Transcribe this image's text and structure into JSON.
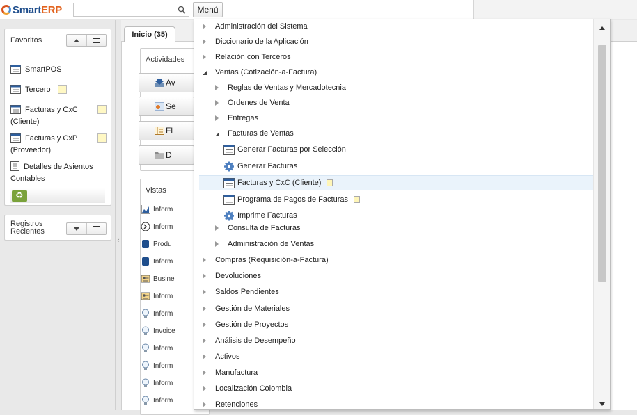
{
  "app": {
    "logo_part1": "Smart",
    "logo_part2": "ERP"
  },
  "search": {
    "placeholder": ""
  },
  "menu_button": "Menú",
  "favorites": {
    "title": "Favoritos",
    "items": [
      {
        "label": "SmartPOS",
        "icon": "window-icon"
      },
      {
        "label": "Tercero",
        "icon": "window-icon",
        "note": true
      },
      {
        "label": "Facturas y CxC (Cliente)",
        "icon": "window-icon",
        "note": true
      },
      {
        "label": "Facturas y CxP (Proveedor)",
        "icon": "window-icon",
        "note": true
      },
      {
        "label": "Detalles de Asientos Contables",
        "icon": "report-icon"
      }
    ]
  },
  "recent": {
    "title": "Registros Recientes"
  },
  "home_tab": "Inicio (35)",
  "activities": {
    "title": "Actividades",
    "buttons": [
      "Av",
      "Se",
      "Fl",
      "D"
    ]
  },
  "views": {
    "title": "Vistas",
    "items": [
      {
        "label": "Inform",
        "icon": "chart-icon"
      },
      {
        "label": "Inform",
        "icon": "clock-icon"
      },
      {
        "label": "Produ",
        "icon": "db-icon"
      },
      {
        "label": "Inform",
        "icon": "db-icon"
      },
      {
        "label": "Busine",
        "icon": "card-icon"
      },
      {
        "label": "Inform",
        "icon": "card-icon"
      },
      {
        "label": "Inform",
        "icon": "bulb-icon"
      },
      {
        "label": "Invoice",
        "icon": "bulb-icon"
      },
      {
        "label": "Inform",
        "icon": "bulb-icon"
      },
      {
        "label": "Inform",
        "icon": "bulb-icon"
      },
      {
        "label": "Inform",
        "icon": "bulb-icon"
      },
      {
        "label": "Inform",
        "icon": "bulb-icon"
      }
    ]
  },
  "menu": {
    "items": [
      {
        "label": "Administración del Sistema",
        "level": 0,
        "type": "folder"
      },
      {
        "label": "Diccionario de la Aplicación",
        "level": 0,
        "type": "folder"
      },
      {
        "label": "Relación con Terceros",
        "level": 0,
        "type": "folder"
      },
      {
        "label": "Ventas (Cotización-a-Factura)",
        "level": 0,
        "type": "folder-open"
      },
      {
        "label": "Reglas de Ventas y Mercadotecnia",
        "level": 1,
        "type": "folder"
      },
      {
        "label": "Ordenes de Venta",
        "level": 1,
        "type": "folder"
      },
      {
        "label": "Entregas",
        "level": 1,
        "type": "folder"
      },
      {
        "label": "Facturas de Ventas",
        "level": 1,
        "type": "folder-open"
      },
      {
        "label": "Generar Facturas por Selección",
        "level": 2,
        "type": "window"
      },
      {
        "label": "Generar Facturas",
        "level": 2,
        "type": "process"
      },
      {
        "label": "Facturas y CxC (Cliente)",
        "level": 2,
        "type": "window",
        "note": true,
        "selected": true
      },
      {
        "label": "Programa de Pagos de Facturas",
        "level": 2,
        "type": "window",
        "note": true
      },
      {
        "label": "Imprime Facturas",
        "level": 2,
        "type": "process"
      },
      {
        "label": "Consulta de Facturas",
        "level": 1,
        "type": "folder"
      },
      {
        "label": "Administración de Ventas",
        "level": 1,
        "type": "folder"
      },
      {
        "label": "Compras (Requisición-a-Factura)",
        "level": 0,
        "type": "folder"
      },
      {
        "label": "Devoluciones",
        "level": 0,
        "type": "folder"
      },
      {
        "label": "Saldos Pendientes",
        "level": 0,
        "type": "folder"
      },
      {
        "label": "Gestión de Materiales",
        "level": 0,
        "type": "folder"
      },
      {
        "label": "Gestión de Proyectos",
        "level": 0,
        "type": "folder"
      },
      {
        "label": "Análisis de Desempeño",
        "level": 0,
        "type": "folder"
      },
      {
        "label": "Activos",
        "level": 0,
        "type": "folder"
      },
      {
        "label": "Manufactura",
        "level": 0,
        "type": "folder"
      },
      {
        "label": "Localización Colombia",
        "level": 0,
        "type": "folder"
      },
      {
        "label": "Retenciones",
        "level": 0,
        "type": "folder"
      }
    ]
  }
}
